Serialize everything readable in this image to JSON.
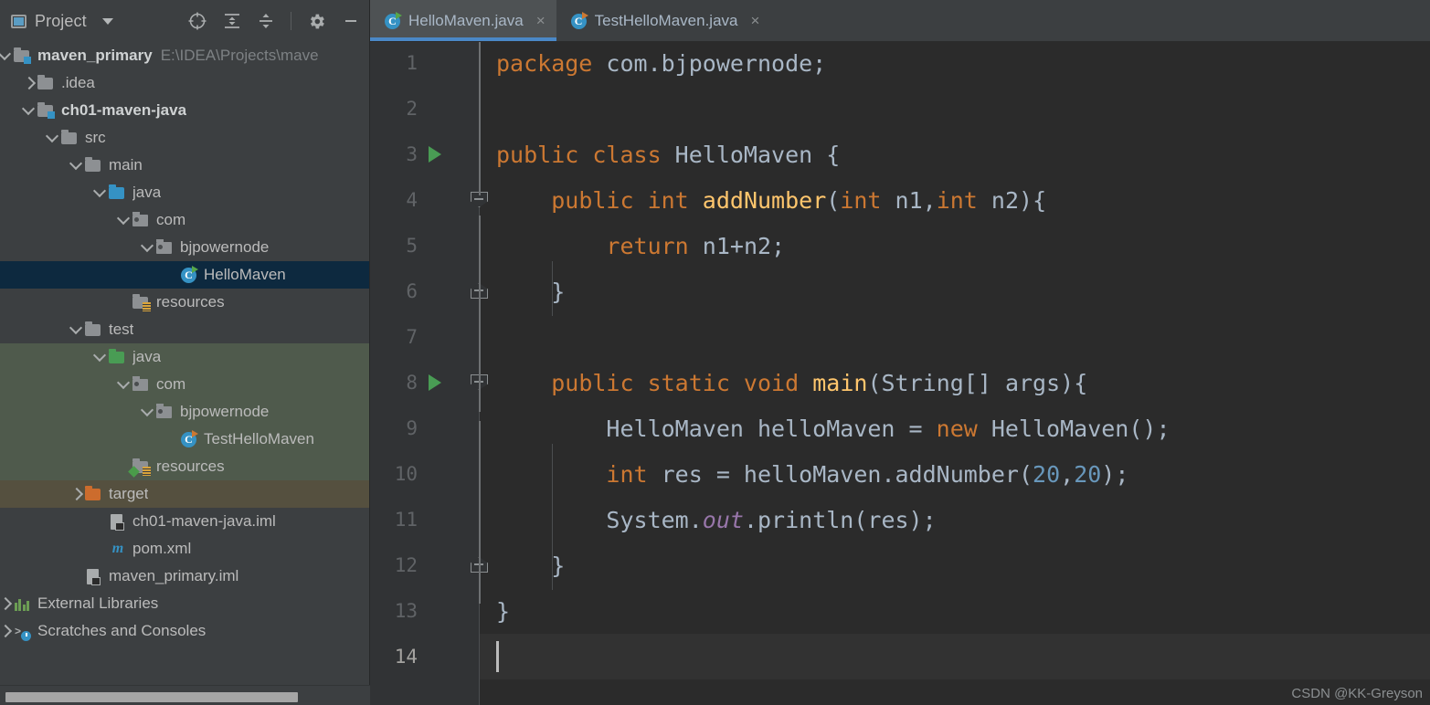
{
  "sidebar": {
    "title": "Project",
    "title_icon": "project-window-icon",
    "dropdown_icon": "chevron-down-icon",
    "toolbar_icons": [
      {
        "name": "locate-icon",
        "tooltip": "Select Opened File"
      },
      {
        "name": "expand-all-icon",
        "tooltip": "Expand All"
      },
      {
        "name": "collapse-all-icon",
        "tooltip": "Collapse All"
      },
      {
        "name": "settings-gear-icon",
        "tooltip": "Settings"
      },
      {
        "name": "minimize-icon",
        "tooltip": "Hide"
      }
    ],
    "tree": [
      {
        "label": "maven_primary",
        "path": "E:\\IDEA\\Projects\\mave",
        "icon": "module-folder-icon",
        "arrow": "down",
        "depth": 0,
        "bold": true,
        "state": "normal"
      },
      {
        "label": ".idea",
        "path": "",
        "icon": "folder-icon",
        "arrow": "right",
        "depth": 1,
        "bold": false,
        "state": "normal"
      },
      {
        "label": "ch01-maven-java",
        "path": "",
        "icon": "module-folder-icon",
        "arrow": "down",
        "depth": 1,
        "bold": true,
        "state": "normal"
      },
      {
        "label": "src",
        "path": "",
        "icon": "folder-icon",
        "arrow": "down",
        "depth": 2,
        "bold": false,
        "state": "normal"
      },
      {
        "label": "main",
        "path": "",
        "icon": "folder-icon",
        "arrow": "down",
        "depth": 3,
        "bold": false,
        "state": "normal"
      },
      {
        "label": "java",
        "path": "",
        "icon": "source-root-folder-icon",
        "arrow": "down",
        "depth": 4,
        "bold": false,
        "state": "normal"
      },
      {
        "label": "com",
        "path": "",
        "icon": "package-icon",
        "arrow": "down",
        "depth": 5,
        "bold": false,
        "state": "normal"
      },
      {
        "label": "bjpowernode",
        "path": "",
        "icon": "package-icon",
        "arrow": "down",
        "depth": 6,
        "bold": false,
        "state": "normal"
      },
      {
        "label": "HelloMaven",
        "path": "",
        "icon": "java-class-runnable-icon",
        "arrow": "none",
        "depth": 7,
        "bold": false,
        "state": "selected"
      },
      {
        "label": "resources",
        "path": "",
        "icon": "resource-root-folder-icon",
        "arrow": "none",
        "depth": 5,
        "bold": false,
        "state": "normal"
      },
      {
        "label": "test",
        "path": "",
        "icon": "folder-icon",
        "arrow": "down",
        "depth": 3,
        "bold": false,
        "state": "normal"
      },
      {
        "label": "java",
        "path": "",
        "icon": "test-source-root-folder-icon",
        "arrow": "down",
        "depth": 4,
        "bold": false,
        "state": "testroot"
      },
      {
        "label": "com",
        "path": "",
        "icon": "package-icon",
        "arrow": "down",
        "depth": 5,
        "bold": false,
        "state": "testroot"
      },
      {
        "label": "bjpowernode",
        "path": "",
        "icon": "package-icon",
        "arrow": "down",
        "depth": 6,
        "bold": false,
        "state": "testroot"
      },
      {
        "label": "TestHelloMaven",
        "path": "",
        "icon": "java-test-class-icon",
        "arrow": "none",
        "depth": 7,
        "bold": false,
        "state": "testroot"
      },
      {
        "label": "resources",
        "path": "",
        "icon": "test-resource-root-folder-icon",
        "arrow": "none",
        "depth": 5,
        "bold": false,
        "state": "testroot"
      },
      {
        "label": "target",
        "path": "",
        "icon": "excluded-folder-icon",
        "arrow": "right",
        "depth": 3,
        "bold": false,
        "state": "target"
      },
      {
        "label": "ch01-maven-java.iml",
        "path": "",
        "icon": "iml-file-icon",
        "arrow": "none",
        "depth": 4,
        "bold": false,
        "state": "normal"
      },
      {
        "label": "pom.xml",
        "path": "",
        "icon": "maven-pom-icon",
        "arrow": "none",
        "depth": 4,
        "bold": false,
        "state": "normal"
      },
      {
        "label": "maven_primary.iml",
        "path": "",
        "icon": "iml-file-icon",
        "arrow": "none",
        "depth": 3,
        "bold": false,
        "state": "normal"
      },
      {
        "label": "External Libraries",
        "path": "",
        "icon": "external-libraries-icon",
        "arrow": "right",
        "depth": 0,
        "bold": false,
        "state": "normal"
      },
      {
        "label": "Scratches and Consoles",
        "path": "",
        "icon": "scratches-icon",
        "arrow": "right",
        "depth": 0,
        "bold": false,
        "state": "normal"
      }
    ]
  },
  "editor": {
    "tabs": [
      {
        "label": "HelloMaven.java",
        "icon": "java-class-runnable-icon",
        "active": true,
        "close_glyph": "×"
      },
      {
        "label": "TestHelloMaven.java",
        "icon": "java-test-class-icon",
        "active": false,
        "close_glyph": "×"
      }
    ],
    "current_line": 14,
    "lines": [
      {
        "n": 1,
        "runnable": false,
        "fold": "none",
        "tokens": [
          {
            "t": "package",
            "c": "kw"
          },
          {
            "t": " com.bjpowernode;",
            "c": "plain"
          }
        ]
      },
      {
        "n": 2,
        "runnable": false,
        "fold": "none",
        "tokens": []
      },
      {
        "n": 3,
        "runnable": true,
        "fold": "none",
        "tokens": [
          {
            "t": "public class",
            "c": "kw"
          },
          {
            "t": " HelloMaven {",
            "c": "plain"
          }
        ]
      },
      {
        "n": 4,
        "runnable": false,
        "fold": "top",
        "tokens": [
          {
            "t": "    ",
            "c": "plain"
          },
          {
            "t": "public int",
            "c": "kw"
          },
          {
            "t": " ",
            "c": "plain"
          },
          {
            "t": "addNumber",
            "c": "meth"
          },
          {
            "t": "(",
            "c": "plain"
          },
          {
            "t": "int",
            "c": "kw"
          },
          {
            "t": " n1,",
            "c": "plain"
          },
          {
            "t": "int",
            "c": "kw"
          },
          {
            "t": " n2){",
            "c": "plain"
          }
        ]
      },
      {
        "n": 5,
        "runnable": false,
        "fold": "none",
        "tokens": [
          {
            "t": "        ",
            "c": "plain"
          },
          {
            "t": "return",
            "c": "kw"
          },
          {
            "t": " n1+n2;",
            "c": "plain"
          }
        ]
      },
      {
        "n": 6,
        "runnable": false,
        "fold": "bottom",
        "tokens": [
          {
            "t": "    }",
            "c": "plain"
          }
        ]
      },
      {
        "n": 7,
        "runnable": false,
        "fold": "none",
        "tokens": []
      },
      {
        "n": 8,
        "runnable": true,
        "fold": "top",
        "tokens": [
          {
            "t": "    ",
            "c": "plain"
          },
          {
            "t": "public static void",
            "c": "kw"
          },
          {
            "t": " ",
            "c": "plain"
          },
          {
            "t": "main",
            "c": "meth"
          },
          {
            "t": "(String[] args){",
            "c": "plain"
          }
        ]
      },
      {
        "n": 9,
        "runnable": false,
        "fold": "none",
        "tokens": [
          {
            "t": "        HelloMaven helloMaven = ",
            "c": "plain"
          },
          {
            "t": "new",
            "c": "kw"
          },
          {
            "t": " HelloMaven();",
            "c": "plain"
          }
        ]
      },
      {
        "n": 10,
        "runnable": false,
        "fold": "none",
        "tokens": [
          {
            "t": "        ",
            "c": "plain"
          },
          {
            "t": "int",
            "c": "kw"
          },
          {
            "t": " res = helloMaven.addNumber(",
            "c": "plain"
          },
          {
            "t": "20",
            "c": "num0"
          },
          {
            "t": ",",
            "c": "plain"
          },
          {
            "t": "20",
            "c": "num0"
          },
          {
            "t": ");",
            "c": "plain"
          }
        ]
      },
      {
        "n": 11,
        "runnable": false,
        "fold": "none",
        "tokens": [
          {
            "t": "        System.",
            "c": "plain"
          },
          {
            "t": "out",
            "c": "stat"
          },
          {
            "t": ".println(res);",
            "c": "plain"
          }
        ]
      },
      {
        "n": 12,
        "runnable": false,
        "fold": "bottom",
        "tokens": [
          {
            "t": "    }",
            "c": "plain"
          }
        ]
      },
      {
        "n": 13,
        "runnable": false,
        "fold": "none",
        "tokens": [
          {
            "t": "}",
            "c": "plain"
          }
        ]
      },
      {
        "n": 14,
        "runnable": false,
        "fold": "none",
        "tokens": []
      }
    ]
  },
  "watermark": "CSDN @KK-Greyson",
  "colors": {
    "sidebar_bg": "#3c3f41",
    "editor_bg": "#2b2b2b",
    "gutter_bg": "#313335",
    "selection_blue": "#0d293f",
    "test_root_green": "#4f5a4c",
    "target_brown": "#55503f",
    "tab_active_underline": "#4a88c7",
    "keyword_orange": "#cc7832",
    "method_yellow": "#ffc66d",
    "number_blue": "#6897bb",
    "static_purple": "#9876aa",
    "text_gray": "#a9b7c6"
  }
}
